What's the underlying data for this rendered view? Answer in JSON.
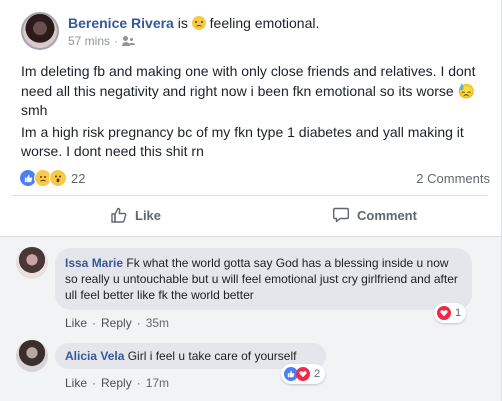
{
  "post": {
    "author": "Berenice Rivera",
    "is_word": "is",
    "feeling": "feeling emotional.",
    "time": "57 mins",
    "dot": "·",
    "text_1": "Im deleting fb and making one with only close friends and relatives. I dont need all this negativity and right now i been fkn emotional so its worse 😓 smh",
    "text_2": "Im a high risk pregnancy bc of my fkn type 1 diabetes and yall making it worse. I dont need this shit rn",
    "reaction_count": "22",
    "comment_count": "2 Comments",
    "reaction_icons": [
      "like-icon",
      "sad-icon",
      "wow-icon"
    ]
  },
  "actions": {
    "like": "Like",
    "comment": "Comment"
  },
  "comments": [
    {
      "name": "Issa Marie",
      "text": "Fk what the world gotta say God has a blessing inside u now so really u untouchable but u will feel emotional just cry girlfriend and after ull feel better like fk the world better",
      "like": "Like",
      "reply": "Reply",
      "time": "35m",
      "reactions": "1",
      "reaction_icons": [
        "love-icon"
      ]
    },
    {
      "name": "Alicia Vela",
      "text": "Girl i feel u take care of yourself",
      "like": "Like",
      "reply": "Reply",
      "time": "17m",
      "reactions": "2",
      "reaction_icons": [
        "like-icon",
        "love-icon"
      ]
    }
  ],
  "colors": {
    "link": "#365899",
    "like_reaction": "#4b80f1",
    "love_reaction": "#f0284a",
    "comments_background": "#f2f3f5"
  }
}
